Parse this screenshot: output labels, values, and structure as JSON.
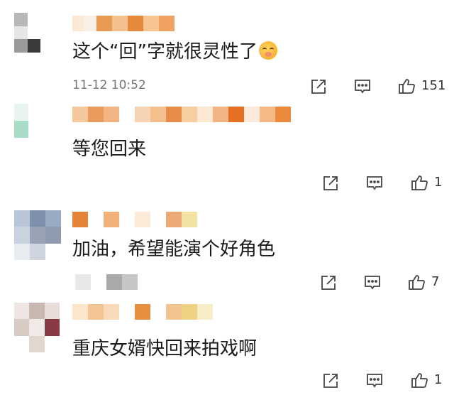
{
  "comments": [
    {
      "text": "这个“回”字就很灵性了",
      "time": "11-12 10:52",
      "like_count": "151",
      "has_emoji": true
    },
    {
      "text": "等您回来",
      "like_count": "1"
    },
    {
      "text": "加油，希望能演个好角色",
      "like_count": "7"
    },
    {
      "text": "重庆女婿快回来拍戏啊",
      "like_count": "1"
    }
  ],
  "icons": {
    "share": "share-icon",
    "reply": "comment-icon",
    "like": "thumbs-up-icon"
  },
  "colors": {
    "meta_text": "#777777",
    "icon_stroke": "#444444"
  }
}
